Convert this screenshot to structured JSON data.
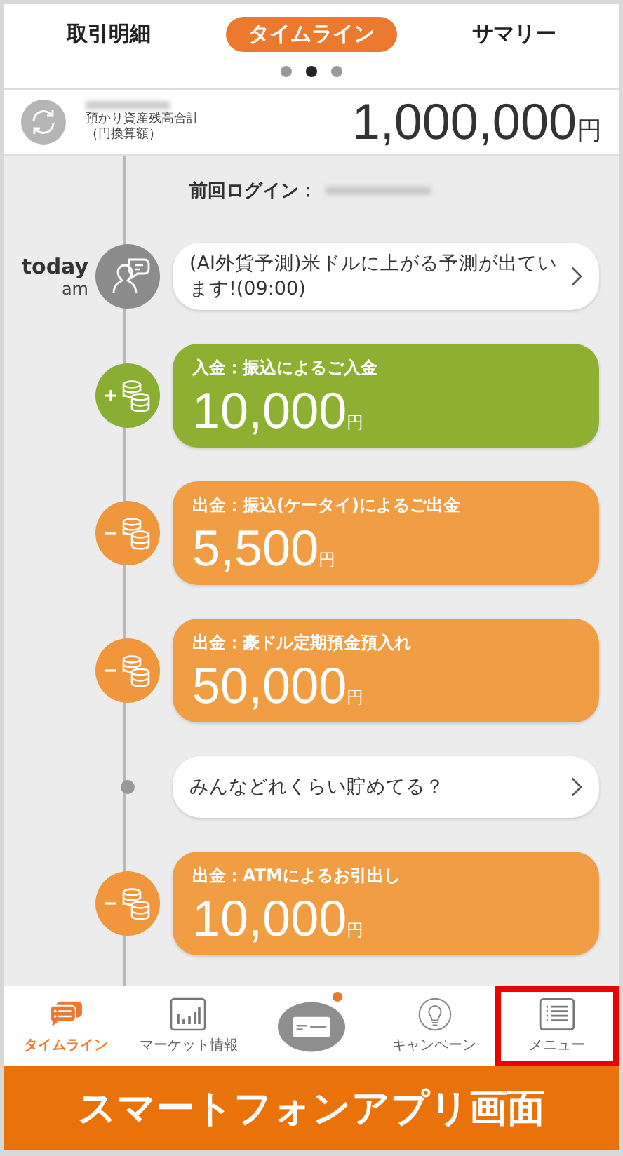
{
  "tabs": [
    {
      "label": "取引明細",
      "selected": false
    },
    {
      "label": "タイムライン",
      "selected": true
    },
    {
      "label": "サマリー",
      "selected": false
    }
  ],
  "page_dots": [
    {
      "selected": false
    },
    {
      "selected": true
    },
    {
      "selected": false
    }
  ],
  "balance": {
    "label": "預かり資産残高合計",
    "sublabel": "（円換算額）",
    "amount": "1,000,000",
    "unit": "円"
  },
  "last_login": {
    "label": "前回ログイン："
  },
  "timeline": [
    {
      "kind": "alert",
      "day": "today",
      "period": "am",
      "text": "(AI外貨予測)米ドルに上がる予測が出ています!(09:00)"
    },
    {
      "kind": "deposit",
      "title": "入金：振込によるご入金",
      "amount": "10,000",
      "unit": "円"
    },
    {
      "kind": "withdrawal",
      "title": "出金：振込(ケータイ)によるご出金",
      "amount": "5,500",
      "unit": "円"
    },
    {
      "kind": "withdrawal",
      "title": "出金：豪ドル定期預金預入れ",
      "amount": "50,000",
      "unit": "円"
    },
    {
      "kind": "message",
      "text": "みんなどれくらい貯めてる？"
    },
    {
      "kind": "withdrawal",
      "title": "出金：ATMによるお引出し",
      "amount": "10,000",
      "unit": "円"
    }
  ],
  "nav": [
    {
      "kind": "timeline",
      "label": "タイムライン",
      "selected": true,
      "badge": false,
      "highlighted": false
    },
    {
      "kind": "market",
      "label": "マーケット情報",
      "selected": false,
      "badge": false,
      "highlighted": false
    },
    {
      "kind": "card",
      "selected": false,
      "badge": true,
      "highlighted": false
    },
    {
      "kind": "campaign",
      "label": "キャンペーン",
      "selected": false,
      "badge": false,
      "highlighted": false
    },
    {
      "kind": "menu",
      "label": "メニュー",
      "selected": false,
      "badge": false,
      "highlighted": true
    }
  ],
  "banner": {
    "text": "スマートフォンアプリ画面"
  }
}
